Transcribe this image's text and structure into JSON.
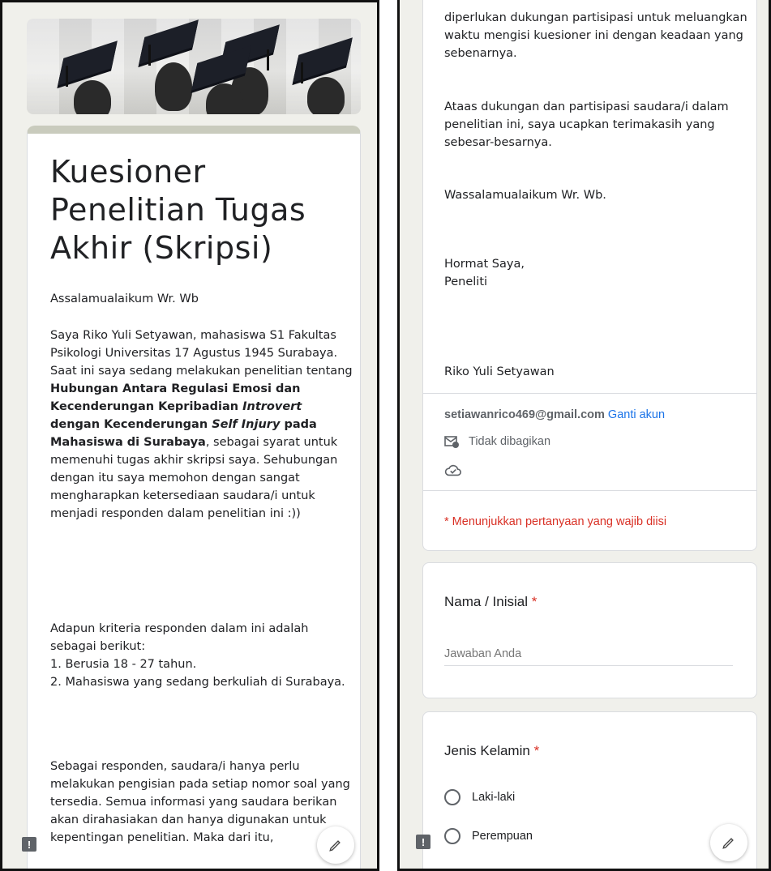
{
  "left": {
    "title": "Kuesioner Penelitian Tugas Akhir (Skripsi)",
    "greeting": "Assalamualaikum Wr. Wb",
    "intro_part1": "Saya Riko Yuli Setyawan, mahasiswa S1 Fakultas Psikologi Universitas 17 Agustus 1945 Surabaya. Saat ini saya sedang melakukan penelitian tentang ",
    "intro_bold1": "Hubungan Antara Regulasi Emosi dan Kecenderungan Kepribadian ",
    "intro_bold_italic1": "Introvert",
    "intro_bold2": " dengan Kecenderungan ",
    "intro_bold_italic2": "Self Injury",
    "intro_bold3": " pada Mahasiswa di Surabaya",
    "intro_part2": ", sebagai syarat untuk memenuhi tugas akhir skripsi saya. Sehubungan dengan itu saya memohon dengan sangat mengharapkan ketersediaan saudara/i untuk menjadi responden dalam penelitian ini :))",
    "criteria_intro": "Adapun kriteria responden dalam ini adalah sebagai berikut:",
    "criteria_1": "1. Berusia 18 - 27 tahun.",
    "criteria_2": "2. Mahasiswa yang sedang berkuliah di Surabaya.",
    "closing": "Sebagai responden, saudara/i hanya perlu melakukan pengisian pada setiap nomor soal yang tersedia. Semua informasi yang saudara berikan akan dirahasiakan dan hanya digunakan untuk kepentingan penelitian. Maka dari itu,"
  },
  "right": {
    "para1": "diperlukan dukungan partisipasi untuk meluangkan waktu mengisi kuesioner ini dengan keadaan yang sebenarnya.",
    "para2": "Ataas dukungan dan partisipasi saudara/i dalam penelitian ini, saya ucapkan terimakasih yang sebesar-besarnya.",
    "para3": "Wassalamualaikum Wr. Wb.",
    "regards": "Hormat Saya,",
    "role": "Peneliti",
    "signature": "Riko Yuli Setyawan",
    "account": {
      "email": "setiawanrico469@gmail.com",
      "switch_label": "Ganti akun",
      "not_shared": "Tidak dibagikan"
    },
    "required_note": "* Menunjukkan pertanyaan yang wajib diisi",
    "questions": [
      {
        "title": "Nama / Inisial",
        "required": "*",
        "placeholder": "Jawaban Anda"
      },
      {
        "title": "Jenis Kelamin",
        "required": "*",
        "options": [
          "Laki-laki",
          "Perempuan"
        ]
      }
    ]
  },
  "colors": {
    "accent": "#c9cbbd",
    "link": "#1a73e8",
    "required": "#d93025",
    "background": "#f0f0eb"
  }
}
